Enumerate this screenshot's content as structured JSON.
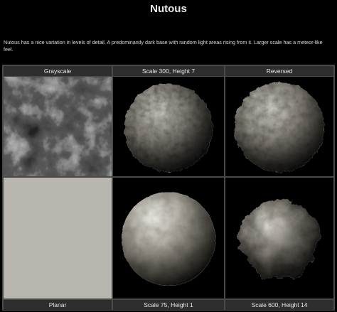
{
  "page": {
    "title": "Nutous",
    "description": "Nutous has a nice variation in levels of detail. A predominantly dark base with random light areas rising from it. Larger scale has a meteor-like feel."
  },
  "grid": {
    "top_labels": [
      "Grayscale",
      "Scale 300, Height 7",
      "Reversed"
    ],
    "bottom_labels": [
      "Planar",
      "Scale 75, Height 1",
      "Scale 600, Height 14"
    ]
  },
  "colors": {
    "background": "#000000",
    "grid_border": "#4a4a4a",
    "label_bar": "#2e2e2e",
    "text": "#e8e8e8"
  }
}
